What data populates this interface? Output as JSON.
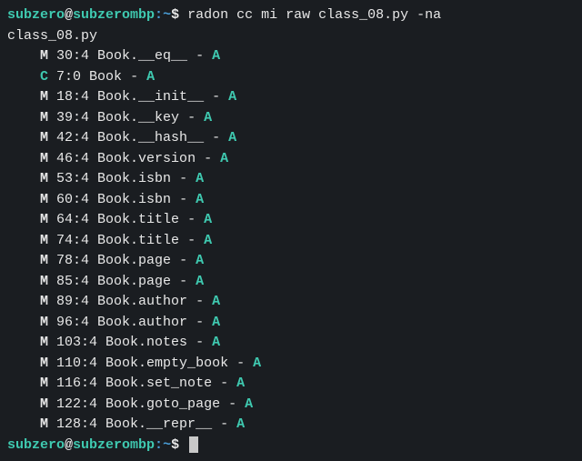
{
  "prompt": {
    "user": "subzero",
    "at": "@",
    "host": "subzerombp",
    "colon": ":",
    "path": "~",
    "dollar": "$"
  },
  "command": "radon cc mi raw class_08.py -na",
  "output_file": "class_08.py",
  "rows": [
    {
      "kind": "M",
      "loc": "30:4",
      "name": "Book.__eq__",
      "grade": "A"
    },
    {
      "kind": "C",
      "loc": "7:0",
      "name": "Book",
      "grade": "A"
    },
    {
      "kind": "M",
      "loc": "18:4",
      "name": "Book.__init__",
      "grade": "A"
    },
    {
      "kind": "M",
      "loc": "39:4",
      "name": "Book.__key",
      "grade": "A"
    },
    {
      "kind": "M",
      "loc": "42:4",
      "name": "Book.__hash__",
      "grade": "A"
    },
    {
      "kind": "M",
      "loc": "46:4",
      "name": "Book.version",
      "grade": "A"
    },
    {
      "kind": "M",
      "loc": "53:4",
      "name": "Book.isbn",
      "grade": "A"
    },
    {
      "kind": "M",
      "loc": "60:4",
      "name": "Book.isbn",
      "grade": "A"
    },
    {
      "kind": "M",
      "loc": "64:4",
      "name": "Book.title",
      "grade": "A"
    },
    {
      "kind": "M",
      "loc": "74:4",
      "name": "Book.title",
      "grade": "A"
    },
    {
      "kind": "M",
      "loc": "78:4",
      "name": "Book.page",
      "grade": "A"
    },
    {
      "kind": "M",
      "loc": "85:4",
      "name": "Book.page",
      "grade": "A"
    },
    {
      "kind": "M",
      "loc": "89:4",
      "name": "Book.author",
      "grade": "A"
    },
    {
      "kind": "M",
      "loc": "96:4",
      "name": "Book.author",
      "grade": "A"
    },
    {
      "kind": "M",
      "loc": "103:4",
      "name": "Book.notes",
      "grade": "A"
    },
    {
      "kind": "M",
      "loc": "110:4",
      "name": "Book.empty_book",
      "grade": "A"
    },
    {
      "kind": "M",
      "loc": "116:4",
      "name": "Book.set_note",
      "grade": "A"
    },
    {
      "kind": "M",
      "loc": "122:4",
      "name": "Book.goto_page",
      "grade": "A"
    },
    {
      "kind": "M",
      "loc": "128:4",
      "name": "Book.__repr__",
      "grade": "A"
    }
  ],
  "dash": " - "
}
